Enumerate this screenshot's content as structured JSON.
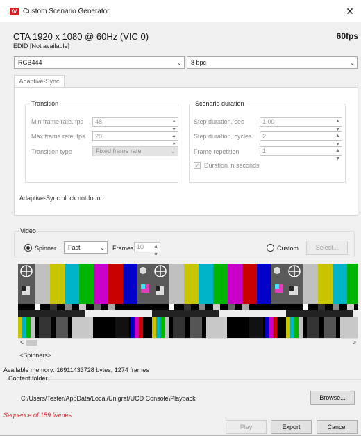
{
  "window": {
    "title": "Custom Scenario Generator",
    "app_icon_text": "///",
    "close_glyph": "✕"
  },
  "header": {
    "mode": "CTA 1920 x 1080 @ 60Hz (VIC 0)",
    "edid": "EDID [Not available]",
    "fps": "60fps"
  },
  "format": {
    "color_value": "RGB444",
    "bpc_value": "8 bpc"
  },
  "tabs": [
    {
      "label": "Adaptive-Sync"
    }
  ],
  "transition": {
    "title": "Transition",
    "min_label": "Min frame rate, fps",
    "min_value": "48",
    "max_label": "Max frame rate, fps",
    "max_value": "20",
    "type_label": "Transition type",
    "type_value": "Fixed frame rate"
  },
  "duration": {
    "title": "Scenario duration",
    "step_sec_label": "Step duration, sec",
    "step_sec_value": "1.00",
    "step_cycles_label": "Step duration, cycles",
    "step_cycles_value": "2",
    "repetition_label": "Frame repetition",
    "repetition_value": "1",
    "in_seconds_label": "Duration in seconds",
    "in_seconds_checked": true
  },
  "info": "Adaptive-Sync block not found.",
  "video": {
    "title": "Video",
    "spinner_label": "Spinner",
    "spinner_selected": true,
    "speed_value": "Fast",
    "frames_label": "Frames:",
    "frames_value": "10",
    "custom_label": "Custom",
    "select_label": "Select..."
  },
  "preview": {
    "spinners_label": "<Spinners>"
  },
  "memory": "Available memory: 16911433728 bytes; 1274 frames",
  "content": {
    "title": "Content folder",
    "path": "C:/Users/Tester/AppData/Local/Unigraf/UCD Console\\Playback",
    "browse_label": "Browse..."
  },
  "status": "Sequence of 159 frames",
  "actions": {
    "play_label": "Play",
    "export_label": "Export",
    "cancel_label": "Cancel"
  },
  "colors": {
    "accent_red": "#d0252b",
    "window_bg": "#f0f0f0"
  }
}
